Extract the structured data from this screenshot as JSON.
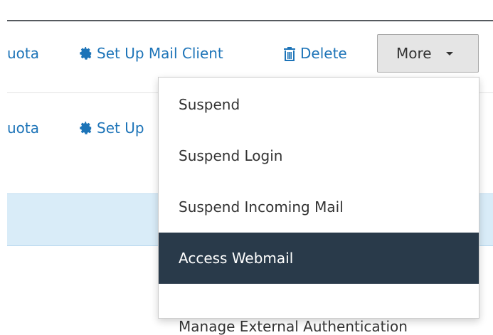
{
  "row1": {
    "quota_partial": "uota",
    "setup_label": "Set Up Mail Client",
    "delete_label": "Delete",
    "more_label": "More"
  },
  "row2": {
    "quota_partial": "uota",
    "setup_partial": "Set Up"
  },
  "dropdown": {
    "items": [
      {
        "label": "Suspend"
      },
      {
        "label": "Suspend Login"
      },
      {
        "label": "Suspend Incoming Mail"
      },
      {
        "label": "Access Webmail",
        "active": true
      },
      {
        "label": "Manage External Authentication"
      }
    ]
  },
  "colors": {
    "link": "#1d74b8",
    "active_item_bg": "#293a4a",
    "row_highlight": "#d9ecf8"
  },
  "icons": {
    "setup": "gear-icon",
    "delete": "trash-icon",
    "more": "caret-down-icon"
  }
}
